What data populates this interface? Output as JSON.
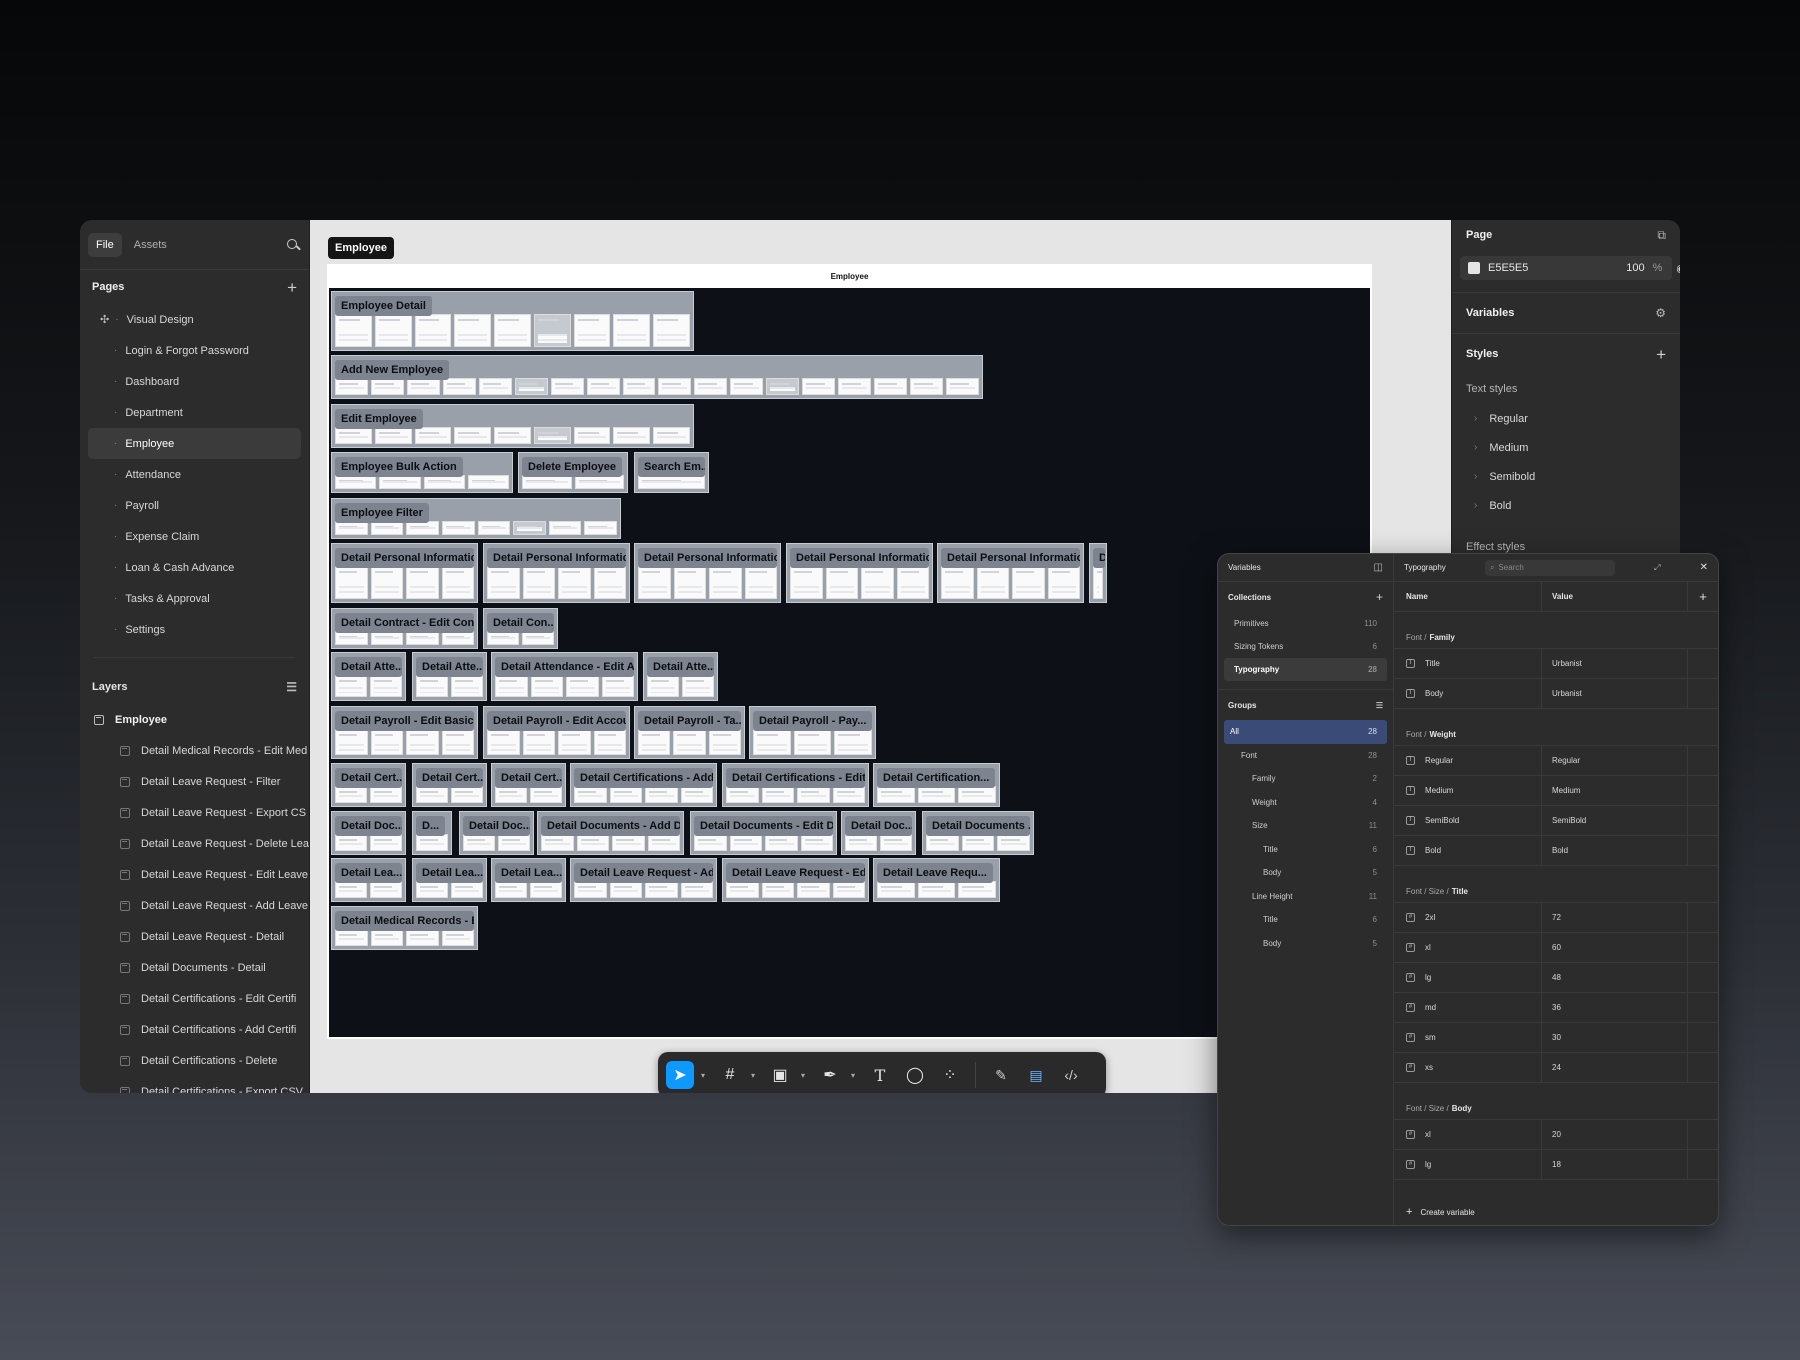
{
  "left_panel": {
    "tabs": [
      "File",
      "Assets"
    ],
    "pages_title": "Pages",
    "pages": [
      {
        "label": "Visual Design",
        "icon": "sparkle-icon",
        "active": false
      },
      {
        "label": "Login & Forgot Password",
        "active": false
      },
      {
        "label": "Dashboard",
        "active": false
      },
      {
        "label": "Department",
        "active": false
      },
      {
        "label": "Employee",
        "active": true
      },
      {
        "label": "Attendance",
        "active": false
      },
      {
        "label": "Payroll",
        "active": false
      },
      {
        "label": "Expense Claim",
        "active": false
      },
      {
        "label": "Loan & Cash Advance",
        "active": false
      },
      {
        "label": "Tasks & Approval",
        "active": false
      },
      {
        "label": "Settings",
        "active": false
      }
    ],
    "layers_title": "Layers",
    "layer_root": "Employee",
    "layers": [
      "Detail Medical Records - Edit Med",
      "Detail Leave Request - Filter",
      "Detail Leave Request - Export CS",
      "Detail Leave Request - Delete Lea",
      "Detail Leave Request - Edit Leave",
      "Detail Leave Request - Add Leave",
      "Detail Leave Request - Detail",
      "Detail Documents - Detail",
      "Detail Certifications - Edit Certifi",
      "Detail Certifications - Add Certifi",
      "Detail Certifications - Delete",
      "Detail Certifications - Export CSV"
    ]
  },
  "canvas": {
    "page_tag": "Employee",
    "board_title": "Employee",
    "sections": [
      {
        "label": "Employee Detail",
        "thumbs": 9
      },
      {
        "label": "Add New Employee",
        "thumbs": 18
      },
      {
        "label": "Edit Employee",
        "thumbs": 9
      },
      {
        "label": "Employee Bulk Action",
        "thumbs": 4
      },
      {
        "label": "Delete Employee",
        "thumbs": 2
      },
      {
        "label": "Search Em...",
        "thumbs": 1
      },
      {
        "label": "Employee Filter",
        "thumbs": 8
      },
      {
        "label": "Detail Personal Information...",
        "thumbs": 4
      },
      {
        "label": "Detail Personal Information...",
        "thumbs": 4
      },
      {
        "label": "Detail Personal Information...",
        "thumbs": 4
      },
      {
        "label": "Detail Personal Information...",
        "thumbs": 4
      },
      {
        "label": "Detail Personal Information...",
        "thumbs": 4
      },
      {
        "label": "D",
        "thumbs": 1
      },
      {
        "label": "Detail Contract - Edit Cont...",
        "thumbs": 4
      },
      {
        "label": "Detail Con...",
        "thumbs": 2
      },
      {
        "label": "Detail Atte...",
        "thumbs": 2
      },
      {
        "label": "Detail Atte...",
        "thumbs": 2
      },
      {
        "label": "Detail Attendance - Edit At...",
        "thumbs": 4
      },
      {
        "label": "Detail Atte...",
        "thumbs": 2
      },
      {
        "label": "Detail Payroll - Edit Basic I...",
        "thumbs": 4
      },
      {
        "label": "Detail Payroll - Edit Accou...",
        "thumbs": 4
      },
      {
        "label": "Detail Payroll - Ta...",
        "thumbs": 3
      },
      {
        "label": "Detail Payroll - Pay...",
        "thumbs": 3
      },
      {
        "label": "Detail Cert...",
        "thumbs": 2
      },
      {
        "label": "Detail Cert...",
        "thumbs": 2
      },
      {
        "label": "Detail Cert...",
        "thumbs": 2
      },
      {
        "label": "Detail Certifications - Add ...",
        "thumbs": 4
      },
      {
        "label": "Detail Certifications - Edit ...",
        "thumbs": 4
      },
      {
        "label": "Detail Certification...",
        "thumbs": 3
      },
      {
        "label": "Detail Doc...",
        "thumbs": 2
      },
      {
        "label": "D...",
        "thumbs": 1
      },
      {
        "label": "Detail Doc...",
        "thumbs": 2
      },
      {
        "label": "Detail Documents - Add D...",
        "thumbs": 4
      },
      {
        "label": "Detail Documents - Edit Do...",
        "thumbs": 4
      },
      {
        "label": "Detail Doc...",
        "thumbs": 2
      },
      {
        "label": "Detail Documents ...",
        "thumbs": 3
      },
      {
        "label": "Detail Lea...",
        "thumbs": 2
      },
      {
        "label": "Detail Lea...",
        "thumbs": 2
      },
      {
        "label": "Detail Lea...",
        "thumbs": 2
      },
      {
        "label": "Detail Leave Request - Ad...",
        "thumbs": 4
      },
      {
        "label": "Detail Leave Request - Edit...",
        "thumbs": 4
      },
      {
        "label": "Detail Leave Requ...",
        "thumbs": 3
      },
      {
        "label": "Detail Medical Records - E...",
        "thumbs": 4
      }
    ]
  },
  "toolbar": {
    "tools": [
      "move-icon",
      "frame-icon",
      "image-icon",
      "pen-icon",
      "text-icon",
      "comment-icon",
      "components-icon",
      "draw-icon",
      "design-icon",
      "code-icon"
    ]
  },
  "right_panel": {
    "page_title": "Page",
    "bg_hex": "E5E5E5",
    "bg_opacity": "100",
    "bg_unit": "%",
    "bg_color": "#e5e5e5",
    "variables_title": "Variables",
    "styles_title": "Styles",
    "text_styles_title": "Text styles",
    "text_styles": [
      "Regular",
      "Medium",
      "Semibold",
      "Bold"
    ],
    "effect_styles_title": "Effect styles"
  },
  "variables_modal": {
    "title": "Variables",
    "collections_title": "Collections",
    "collections": [
      {
        "name": "Primitives",
        "count": "110",
        "active": false
      },
      {
        "name": "Sizing Tokens",
        "count": "6",
        "active": false
      },
      {
        "name": "Typography",
        "count": "28",
        "active": true
      }
    ],
    "groups_title": "Groups",
    "groups": [
      {
        "name": "All",
        "count": "28",
        "level": 0,
        "active": true
      },
      {
        "name": "Font",
        "count": "28",
        "level": 1,
        "active": false
      },
      {
        "name": "Family",
        "count": "2",
        "level": 2,
        "active": false
      },
      {
        "name": "Weight",
        "count": "4",
        "level": 2,
        "active": false
      },
      {
        "name": "Size",
        "count": "11",
        "level": 2,
        "active": false
      },
      {
        "name": "Title",
        "count": "6",
        "level": 3,
        "active": false
      },
      {
        "name": "Body",
        "count": "5",
        "level": 3,
        "active": false
      },
      {
        "name": "Line Height",
        "count": "11",
        "level": 2,
        "active": false
      },
      {
        "name": "Title",
        "count": "6",
        "level": 3,
        "active": false
      },
      {
        "name": "Body",
        "count": "5",
        "level": 3,
        "active": false
      }
    ],
    "collection_name": "Typography",
    "search_placeholder": "Search",
    "col_name": "Name",
    "col_value": "Value",
    "groups_table": [
      {
        "path": "Font /",
        "name": "Family",
        "rows": [
          {
            "name": "Title",
            "value": "Urbanist",
            "icon": "T"
          },
          {
            "name": "Body",
            "value": "Urbanist",
            "icon": "T"
          }
        ]
      },
      {
        "path": "Font /",
        "name": "Weight",
        "rows": [
          {
            "name": "Regular",
            "value": "Regular",
            "icon": "T"
          },
          {
            "name": "Medium",
            "value": "Medium",
            "icon": "T"
          },
          {
            "name": "SemiBold",
            "value": "SemiBold",
            "icon": "T"
          },
          {
            "name": "Bold",
            "value": "Bold",
            "icon": "T"
          }
        ]
      },
      {
        "path": "Font / Size /",
        "name": "Title",
        "rows": [
          {
            "name": "2xl",
            "value": "72",
            "icon": "#"
          },
          {
            "name": "xl",
            "value": "60",
            "icon": "#"
          },
          {
            "name": "lg",
            "value": "48",
            "icon": "#"
          },
          {
            "name": "md",
            "value": "36",
            "icon": "#"
          },
          {
            "name": "sm",
            "value": "30",
            "icon": "#"
          },
          {
            "name": "xs",
            "value": "24",
            "icon": "#"
          }
        ]
      },
      {
        "path": "Font / Size /",
        "name": "Body",
        "rows": [
          {
            "name": "xl",
            "value": "20",
            "icon": "#"
          },
          {
            "name": "lg",
            "value": "18",
            "icon": "#"
          }
        ]
      }
    ],
    "create_label": "Create variable"
  }
}
